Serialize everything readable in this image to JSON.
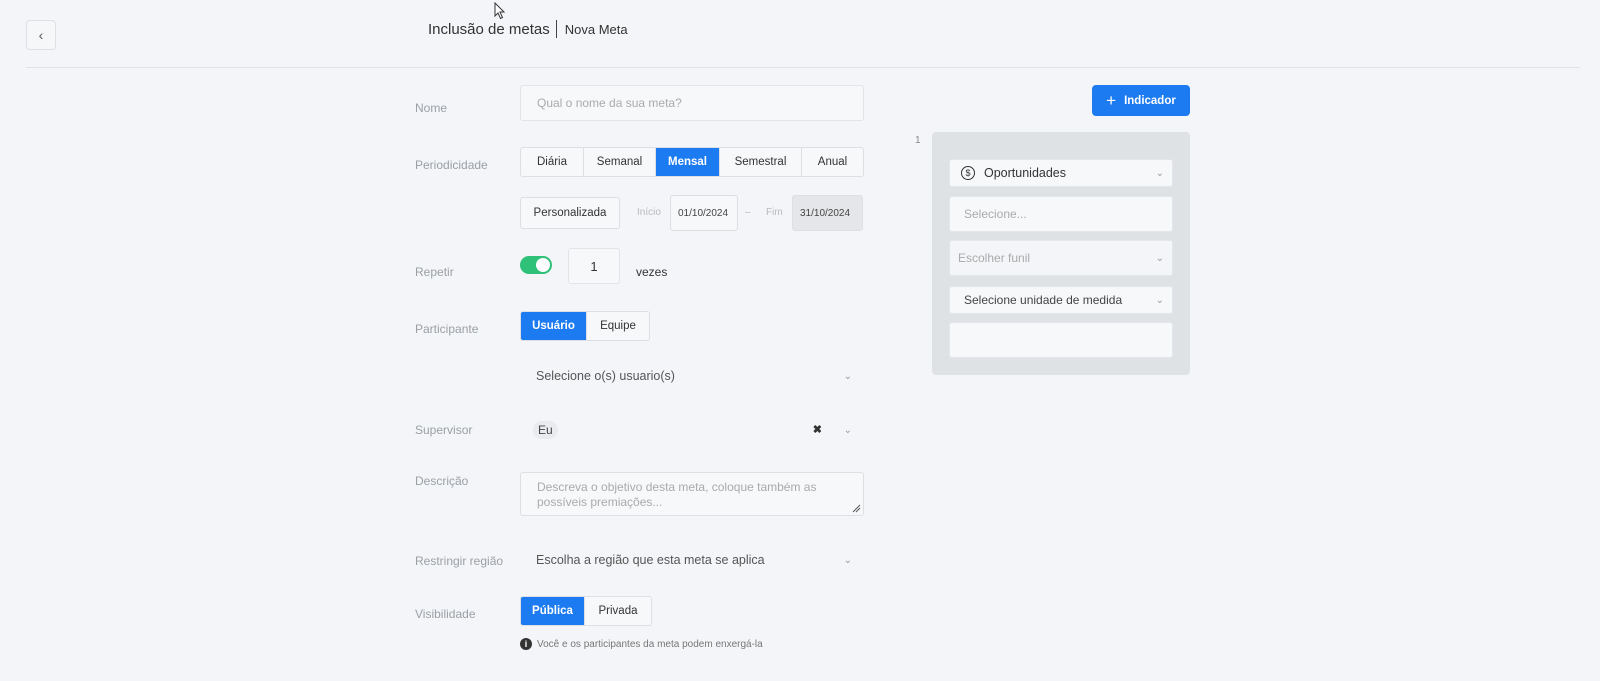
{
  "header": {
    "title": "Inclusão de metas",
    "subtitle": "Nova Meta"
  },
  "form": {
    "nome": {
      "label": "Nome",
      "placeholder": "Qual o nome da sua meta?"
    },
    "periodicidade": {
      "label": "Periodicidade",
      "options": [
        "Diária",
        "Semanal",
        "Mensal",
        "Semestral",
        "Anual"
      ],
      "selected": "Mensal",
      "custom_label": "Personalizada",
      "start_label": "Início",
      "start_date": "01/10/2024",
      "dash": "–",
      "end_label": "Fim",
      "end_date": "31/10/2024"
    },
    "repetir": {
      "label": "Repetir",
      "enabled": true,
      "count": "1",
      "unit": "vezes"
    },
    "participante": {
      "label": "Participante",
      "options": [
        "Usuário",
        "Equipe"
      ],
      "selected": "Usuário",
      "select_placeholder": "Selecione o(s) usuario(s)"
    },
    "supervisor": {
      "label": "Supervisor",
      "value": "Eu"
    },
    "descricao": {
      "label": "Descrição",
      "placeholder": "Descreva o objetivo desta meta, coloque também as possíveis premiações..."
    },
    "regiao": {
      "label": "Restringir região",
      "placeholder": "Escolha a região que esta meta se aplica"
    },
    "visibilidade": {
      "label": "Visibilidade",
      "options": [
        "Pública",
        "Privada"
      ],
      "selected": "Pública",
      "hint": "Você e os participantes da meta podem enxergá-la"
    }
  },
  "indicator": {
    "add_button": "Indicador",
    "index": "1",
    "type": "Oportunidades",
    "select_placeholder": "Selecione...",
    "funnel_placeholder": "Escolher funil",
    "unit_placeholder": "Selecione unidade de medida",
    "value": ""
  },
  "colors": {
    "primary": "#1c7bf0",
    "toggle_on": "#2ec177",
    "background": "#f3f5f8"
  }
}
